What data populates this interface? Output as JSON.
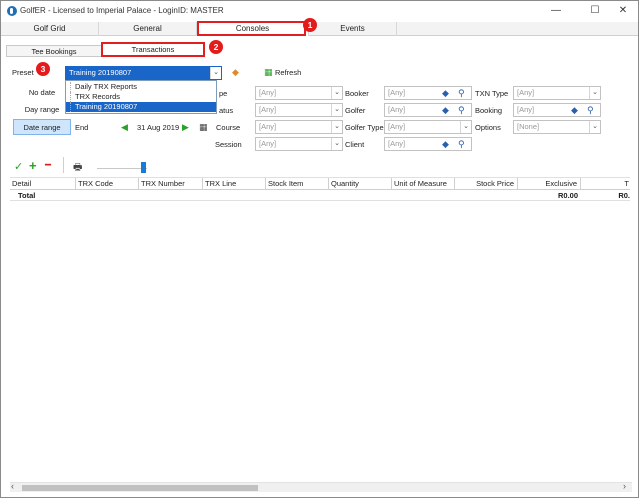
{
  "window": {
    "title": "GolfER - Licensed to Imperial Palace - LoginID: MASTER",
    "minimize_glyph": "—",
    "maximize_glyph": "☐",
    "close_glyph": "✕"
  },
  "top_tabs": [
    "Golf Grid",
    "General",
    "Consoles",
    "Events"
  ],
  "sub_tabs": [
    "Tee Bookings",
    "Transactions"
  ],
  "badges": [
    "1",
    "2",
    "3"
  ],
  "preset": {
    "label": "Preset",
    "value": "Training 20190807",
    "options": [
      "Daily TRX Reports",
      "TRX Records",
      "Training 20190807"
    ]
  },
  "refresh_label": "Refresh",
  "date_modes": [
    "No date",
    "Day range",
    "Date range"
  ],
  "end_label": "End",
  "end_date": "31 Aug 2019",
  "filters": {
    "type_label": "pe",
    "type_value": "[Any]",
    "status_label": "atus",
    "status_value": "[Any]",
    "course_label": "Course",
    "course_value": "[Any]",
    "session_label": "Session",
    "session_value": "[Any]",
    "booker_label": "Booker",
    "booker_value": "[Any]",
    "golfer_label": "Golfer",
    "golfer_value": "[Any]",
    "golfer_type_label": "Golfer Type",
    "golfer_type_value": "[Any]",
    "client_label": "Client",
    "client_value": "[Any]",
    "txn_type_label": "TXN Type",
    "txn_type_value": "[Any]",
    "booking_label": "Booking",
    "booking_value": "[Any]",
    "options_label": "Options",
    "options_value": "[None]"
  },
  "grid": {
    "columns": [
      "Detail",
      "TRX Code",
      "TRX Number",
      "TRX Line",
      "Stock Item",
      "Quantity",
      "Unit of Measure",
      "Stock Price",
      "Exclusive",
      "T"
    ],
    "total_label": "Total",
    "total_exclusive": "R0.00",
    "total_last": "R0."
  },
  "icons": {
    "check": "✓",
    "add": "+",
    "remove": "━",
    "print": "🖶",
    "eraser": "◆",
    "search": "⚲",
    "arrow_left": "◀",
    "arrow_right": "▶",
    "calendar": "▦",
    "dropdown": "⌄",
    "scroll_left": "‹",
    "scroll_right": "›"
  },
  "colors": {
    "accent_red": "#e41b1b",
    "selection_blue": "#1a66c8",
    "green_icon": "#2aa12a"
  }
}
